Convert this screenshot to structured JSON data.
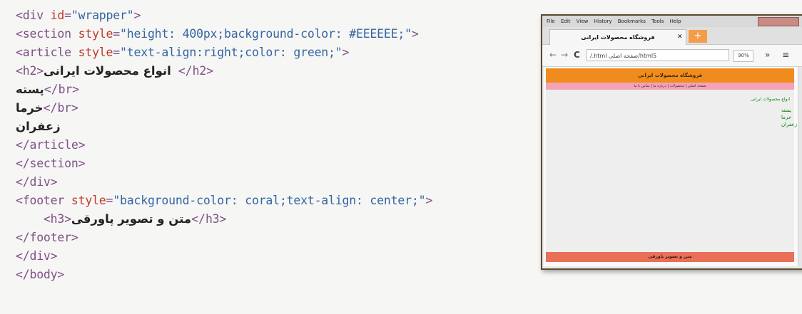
{
  "code": {
    "lines": [
      {
        "tag_open": "<div ",
        "attr": "id",
        "eq": "=",
        "val": "\"wrapper\"",
        "close": ">"
      },
      {
        "tag_open": "<section ",
        "attr": "style",
        "eq": "=",
        "val": "\"height: 400px;background-color: #EEEEEE;\"",
        "close": ">"
      },
      {
        "tag_open": "<article ",
        "attr": "style",
        "eq": "=",
        "val": "\"text-align:right;color: green;\"",
        "close": ">"
      },
      {
        "before": "<h2>",
        "text": "انواع محصولات ایرانی",
        "after": " </h2>"
      },
      {
        "text": "پسته",
        "after": "</br>"
      },
      {
        "text": "خرما",
        "after": "</br>"
      },
      {
        "text": "زعفران"
      },
      {
        "plain": "</article>"
      },
      {
        "plain": "</section>"
      },
      {
        "plain": "</div>"
      },
      {
        "tag_open": "<footer ",
        "attr": "style",
        "eq": "=",
        "val": "\"background-color: coral;text-align: center;\"",
        "close": ">"
      },
      {
        "indent": "    ",
        "before": "<h3>",
        "text": "متن و تصویر پاورقی",
        "after": "</h3>"
      },
      {
        "plain": "</footer>"
      },
      {
        "plain": "</div>"
      },
      {
        "plain": "</body>"
      }
    ]
  },
  "browser": {
    "menu": [
      "File",
      "Edit",
      "View",
      "History",
      "Bookmarks",
      "Tools",
      "Help"
    ],
    "tab_title": "فروشگاه محصولات ایرانی",
    "tab_close": "✕",
    "new_tab": "+",
    "url": "/.html صفحه اصلی/html5",
    "zoom": "90%",
    "nav": {
      "back": "←",
      "forward": "→",
      "reload": "C",
      "more": "»",
      "menu": "≡"
    }
  },
  "page": {
    "header": "فروشگاه محصولات ایرانی",
    "nav": "صفحه اصلی | محصولات | درباره ما | تماس با ما",
    "article_title": "انواع محصولات ایرانی",
    "article_items": "پسته خرما زعفران",
    "footer": "متن و تصویر پاورقی"
  }
}
